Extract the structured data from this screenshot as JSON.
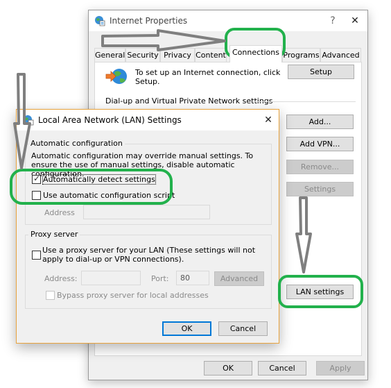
{
  "internet_properties": {
    "title": "Internet Properties",
    "help_button": "?",
    "close_button": "✕",
    "tabs": [
      {
        "label": "General"
      },
      {
        "label": "Security"
      },
      {
        "label": "Privacy"
      },
      {
        "label": "Content"
      },
      {
        "label": "Connections",
        "active": true
      },
      {
        "label": "Programs"
      },
      {
        "label": "Advanced"
      }
    ],
    "setup_text": "To set up an Internet connection, click Setup.",
    "setup_button": "Setup",
    "dialup_section": "Dial-up and Virtual Private Network settings",
    "add_button": "Add...",
    "add_vpn_button": "Add VPN...",
    "remove_button": "Remove...",
    "settings_button": "Settings",
    "lan_settings_button": "LAN settings",
    "ok_button": "OK",
    "cancel_button": "Cancel",
    "apply_button": "Apply"
  },
  "lan_dialog": {
    "title": "Local Area Network (LAN) Settings",
    "close_button": "✕",
    "auto_config": {
      "label": "Automatic configuration",
      "description": "Automatic configuration may override manual settings.  To ensure the use of manual settings, disable automatic configuration.",
      "auto_detect_label": "Automatically detect settings",
      "auto_detect_checked": true,
      "use_script_label": "Use automatic configuration script",
      "use_script_checked": false,
      "address_label": "Address",
      "address_value": ""
    },
    "proxy": {
      "label": "Proxy server",
      "use_proxy_label": "Use a proxy server for your LAN (These settings will not apply to dial-up or VPN connections).",
      "use_proxy_checked": false,
      "address_label": "Address:",
      "address_value": "",
      "port_label": "Port:",
      "port_value": "80",
      "advanced_button": "Advanced",
      "bypass_label": "Bypass proxy server for local addresses",
      "bypass_checked": false
    },
    "ok_button": "OK",
    "cancel_button": "Cancel"
  },
  "annotation_colors": {
    "highlight": "#22b14c",
    "arrow": "#7f7f7f",
    "focus": "#0078d7",
    "dialog_border": "#e8a33d"
  }
}
